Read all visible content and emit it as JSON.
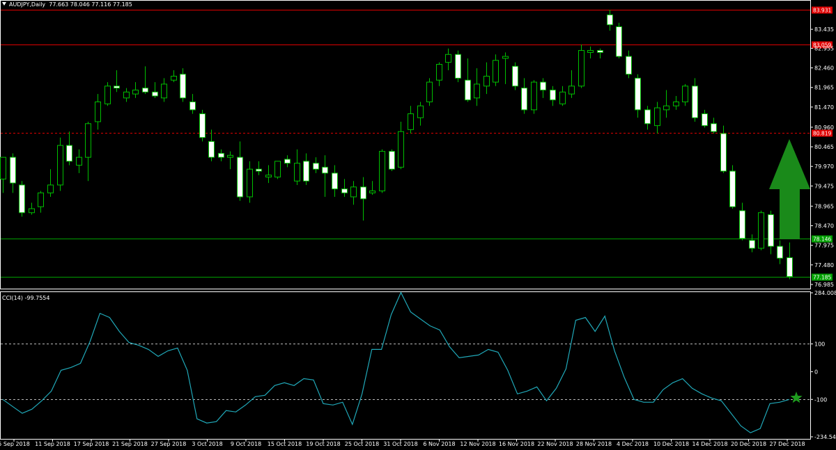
{
  "header": {
    "symbol_timeframe": "AUDJPY,Daily",
    "ohlc": "77.663 78.046 77.116 77.185"
  },
  "indicator": {
    "label": "CCI(14) -99.7554"
  },
  "colors": {
    "background": "#000000",
    "bull_body": "#000000",
    "bear_body": "#FFFFFF",
    "wick": "#00C000",
    "resistance_line": "#E00000",
    "support_line": "#00A000",
    "cci_line": "#20A8B8",
    "arrow": "#1A8A1A",
    "star": "#1E9A1E"
  },
  "chart_data": [
    {
      "type": "candlestick",
      "title": "AUDJPY,Daily",
      "ylim": [
        76.985,
        84.0
      ],
      "y_axis_ticks": [
        "83.435",
        "82.955",
        "82.460",
        "81.965",
        "81.470",
        "80.960",
        "80.465",
        "79.970",
        "79.475",
        "78.965",
        "78.470",
        "77.975",
        "77.480",
        "76.985"
      ],
      "x_axis_ticks": [
        "5 Sep 2018",
        "11 Sep 2018",
        "17 Sep 2018",
        "21 Sep 2018",
        "27 Sep 2018",
        "3 Oct 2018",
        "9 Oct 2018",
        "15 Oct 2018",
        "19 Oct 2018",
        "25 Oct 2018",
        "31 Oct 2018",
        "6 Nov 2018",
        "12 Nov 2018",
        "16 Nov 2018",
        "22 Nov 2018",
        "28 Nov 2018",
        "4 Dec 2018",
        "10 Dec 2018",
        "14 Dec 2018",
        "20 Dec 2018",
        "27 Dec 2018"
      ],
      "horizontal_levels": [
        {
          "value": 83.931,
          "label": "83.931",
          "style": "solid",
          "color": "#E00000"
        },
        {
          "value": 83.059,
          "label": "83.059",
          "style": "solid",
          "color": "#E00000"
        },
        {
          "value": 80.819,
          "label": "80.819",
          "style": "dashed",
          "color": "#E00000"
        },
        {
          "value": 78.146,
          "label": "78.146",
          "style": "solid",
          "color": "#00A000"
        },
        {
          "value": 77.185,
          "label": "77.185",
          "style": "solid",
          "color": "#00A000"
        }
      ],
      "candles": [
        {
          "o": 79.65,
          "h": 80.0,
          "l": 79.3,
          "c": 80.2
        },
        {
          "o": 80.2,
          "h": 80.3,
          "l": 79.3,
          "c": 79.55
        },
        {
          "o": 79.5,
          "h": 79.6,
          "l": 78.7,
          "c": 78.8
        },
        {
          "o": 78.8,
          "h": 79.05,
          "l": 78.75,
          "c": 78.9
        },
        {
          "o": 78.95,
          "h": 79.35,
          "l": 78.8,
          "c": 79.3
        },
        {
          "o": 79.3,
          "h": 79.9,
          "l": 79.2,
          "c": 79.5
        },
        {
          "o": 79.5,
          "h": 80.7,
          "l": 79.35,
          "c": 80.5
        },
        {
          "o": 80.5,
          "h": 80.85,
          "l": 80.0,
          "c": 80.1
        },
        {
          "o": 80.0,
          "h": 80.4,
          "l": 79.8,
          "c": 80.2
        },
        {
          "o": 80.2,
          "h": 81.1,
          "l": 79.6,
          "c": 81.05
        },
        {
          "o": 81.1,
          "h": 81.8,
          "l": 80.9,
          "c": 81.6
        },
        {
          "o": 81.55,
          "h": 82.1,
          "l": 81.5,
          "c": 82.0
        },
        {
          "o": 82.0,
          "h": 82.4,
          "l": 81.85,
          "c": 81.95
        },
        {
          "o": 81.7,
          "h": 81.95,
          "l": 81.6,
          "c": 81.85
        },
        {
          "o": 81.8,
          "h": 82.1,
          "l": 81.7,
          "c": 81.9
        },
        {
          "o": 81.95,
          "h": 82.5,
          "l": 81.8,
          "c": 81.85
        },
        {
          "o": 81.85,
          "h": 82.1,
          "l": 81.7,
          "c": 81.75
        },
        {
          "o": 81.7,
          "h": 82.2,
          "l": 81.6,
          "c": 82.05
        },
        {
          "o": 82.15,
          "h": 82.4,
          "l": 82.1,
          "c": 82.25
        },
        {
          "o": 82.3,
          "h": 82.45,
          "l": 81.6,
          "c": 81.7
        },
        {
          "o": 81.6,
          "h": 81.8,
          "l": 81.3,
          "c": 81.4
        },
        {
          "o": 81.3,
          "h": 81.4,
          "l": 80.6,
          "c": 80.7
        },
        {
          "o": 80.6,
          "h": 80.9,
          "l": 80.1,
          "c": 80.2
        },
        {
          "o": 80.3,
          "h": 80.4,
          "l": 80.1,
          "c": 80.2
        },
        {
          "o": 80.2,
          "h": 80.35,
          "l": 79.9,
          "c": 80.25
        },
        {
          "o": 80.2,
          "h": 80.6,
          "l": 79.1,
          "c": 79.2
        },
        {
          "o": 79.2,
          "h": 80.1,
          "l": 79.05,
          "c": 79.9
        },
        {
          "o": 79.9,
          "h": 80.1,
          "l": 79.75,
          "c": 79.85
        },
        {
          "o": 79.7,
          "h": 80.0,
          "l": 79.55,
          "c": 79.75
        },
        {
          "o": 79.7,
          "h": 80.1,
          "l": 79.65,
          "c": 80.1
        },
        {
          "o": 80.15,
          "h": 80.25,
          "l": 79.95,
          "c": 80.05
        },
        {
          "o": 79.6,
          "h": 80.4,
          "l": 79.5,
          "c": 80.05
        },
        {
          "o": 80.1,
          "h": 80.3,
          "l": 79.5,
          "c": 79.6
        },
        {
          "o": 80.05,
          "h": 80.2,
          "l": 79.8,
          "c": 79.9
        },
        {
          "o": 79.95,
          "h": 80.25,
          "l": 79.2,
          "c": 79.8
        },
        {
          "o": 79.8,
          "h": 80.0,
          "l": 79.2,
          "c": 79.4
        },
        {
          "o": 79.4,
          "h": 79.65,
          "l": 79.2,
          "c": 79.3
        },
        {
          "o": 79.2,
          "h": 79.6,
          "l": 79.0,
          "c": 79.45
        },
        {
          "o": 79.45,
          "h": 79.7,
          "l": 78.6,
          "c": 79.15
        },
        {
          "o": 79.3,
          "h": 79.6,
          "l": 79.25,
          "c": 79.35
        },
        {
          "o": 79.35,
          "h": 80.4,
          "l": 79.3,
          "c": 80.35
        },
        {
          "o": 80.35,
          "h": 80.4,
          "l": 79.85,
          "c": 79.9
        },
        {
          "o": 79.95,
          "h": 81.1,
          "l": 79.9,
          "c": 80.85
        },
        {
          "o": 80.9,
          "h": 81.5,
          "l": 80.8,
          "c": 81.3
        },
        {
          "o": 81.2,
          "h": 81.6,
          "l": 81.0,
          "c": 81.5
        },
        {
          "o": 81.6,
          "h": 82.2,
          "l": 81.5,
          "c": 82.1
        },
        {
          "o": 82.15,
          "h": 82.6,
          "l": 82.0,
          "c": 82.55
        },
        {
          "o": 82.6,
          "h": 82.95,
          "l": 82.4,
          "c": 82.8
        },
        {
          "o": 82.8,
          "h": 82.9,
          "l": 82.1,
          "c": 82.2
        },
        {
          "o": 82.15,
          "h": 82.7,
          "l": 81.6,
          "c": 81.65
        },
        {
          "o": 81.7,
          "h": 82.45,
          "l": 81.5,
          "c": 82.05
        },
        {
          "o": 82.0,
          "h": 82.6,
          "l": 81.8,
          "c": 82.25
        },
        {
          "o": 82.1,
          "h": 82.8,
          "l": 82.0,
          "c": 82.65
        },
        {
          "o": 82.7,
          "h": 82.85,
          "l": 82.05,
          "c": 82.75
        },
        {
          "o": 82.5,
          "h": 82.6,
          "l": 81.9,
          "c": 82.0
        },
        {
          "o": 81.95,
          "h": 82.2,
          "l": 81.3,
          "c": 81.4
        },
        {
          "o": 81.4,
          "h": 82.15,
          "l": 81.3,
          "c": 82.1
        },
        {
          "o": 82.1,
          "h": 82.2,
          "l": 81.7,
          "c": 81.9
        },
        {
          "o": 81.9,
          "h": 82.0,
          "l": 81.5,
          "c": 81.65
        },
        {
          "o": 81.55,
          "h": 82.0,
          "l": 81.5,
          "c": 81.85
        },
        {
          "o": 81.8,
          "h": 82.4,
          "l": 81.7,
          "c": 82.0
        },
        {
          "o": 82.0,
          "h": 83.05,
          "l": 81.95,
          "c": 82.9
        },
        {
          "o": 82.85,
          "h": 83.0,
          "l": 82.7,
          "c": 82.9
        },
        {
          "o": 82.9,
          "h": 82.95,
          "l": 82.7,
          "c": 82.85
        },
        {
          "o": 83.8,
          "h": 83.93,
          "l": 83.4,
          "c": 83.55
        },
        {
          "o": 83.5,
          "h": 83.6,
          "l": 82.7,
          "c": 82.75
        },
        {
          "o": 82.75,
          "h": 82.9,
          "l": 82.2,
          "c": 82.3
        },
        {
          "o": 82.2,
          "h": 82.3,
          "l": 81.2,
          "c": 81.4
        },
        {
          "o": 81.4,
          "h": 81.5,
          "l": 80.9,
          "c": 81.05
        },
        {
          "o": 81.0,
          "h": 81.6,
          "l": 80.8,
          "c": 81.45
        },
        {
          "o": 81.4,
          "h": 81.9,
          "l": 81.2,
          "c": 81.5
        },
        {
          "o": 81.5,
          "h": 81.75,
          "l": 81.4,
          "c": 81.6
        },
        {
          "o": 81.6,
          "h": 82.05,
          "l": 81.5,
          "c": 82.0
        },
        {
          "o": 82.0,
          "h": 82.2,
          "l": 81.1,
          "c": 81.2
        },
        {
          "o": 81.3,
          "h": 81.4,
          "l": 80.95,
          "c": 81.0
        },
        {
          "o": 81.05,
          "h": 81.2,
          "l": 80.8,
          "c": 80.85
        },
        {
          "o": 80.8,
          "h": 81.0,
          "l": 79.8,
          "c": 79.85
        },
        {
          "o": 79.85,
          "h": 80.0,
          "l": 78.9,
          "c": 78.95
        },
        {
          "o": 78.85,
          "h": 79.05,
          "l": 78.1,
          "c": 78.15
        },
        {
          "o": 78.1,
          "h": 78.25,
          "l": 77.8,
          "c": 77.9
        },
        {
          "o": 77.9,
          "h": 78.85,
          "l": 77.85,
          "c": 78.8
        },
        {
          "o": 78.75,
          "h": 78.85,
          "l": 77.75,
          "c": 77.95
        },
        {
          "o": 77.95,
          "h": 78.1,
          "l": 77.5,
          "c": 77.65
        },
        {
          "o": 77.663,
          "h": 78.046,
          "l": 77.116,
          "c": 77.185
        }
      ],
      "annotations": [
        "up-arrow",
        "star"
      ]
    },
    {
      "type": "line",
      "title": "CCI(14) -99.7554",
      "ylim": [
        -234.549,
        284.0082
      ],
      "y_axis_ticks": [
        "284.0082",
        "100",
        "0",
        "-100",
        "-234.549"
      ],
      "reference_levels": [
        100,
        -100
      ],
      "values": [
        -100,
        -125,
        -150,
        -135,
        -105,
        -70,
        5,
        15,
        30,
        110,
        210,
        195,
        145,
        105,
        95,
        80,
        55,
        75,
        85,
        5,
        -170,
        -185,
        -180,
        -140,
        -145,
        -120,
        -90,
        -85,
        -50,
        -40,
        -50,
        -25,
        -30,
        -115,
        -120,
        -110,
        -190,
        -80,
        80,
        80,
        205,
        285,
        215,
        190,
        165,
        150,
        90,
        50,
        55,
        60,
        80,
        70,
        5,
        -80,
        -70,
        -55,
        -105,
        -60,
        10,
        185,
        195,
        145,
        200,
        75,
        -20,
        -100,
        -110,
        -110,
        -65,
        -40,
        -25,
        -60,
        -80,
        -95,
        -105,
        -150,
        -195,
        -220,
        -205,
        -115,
        -110,
        -100
      ]
    }
  ]
}
